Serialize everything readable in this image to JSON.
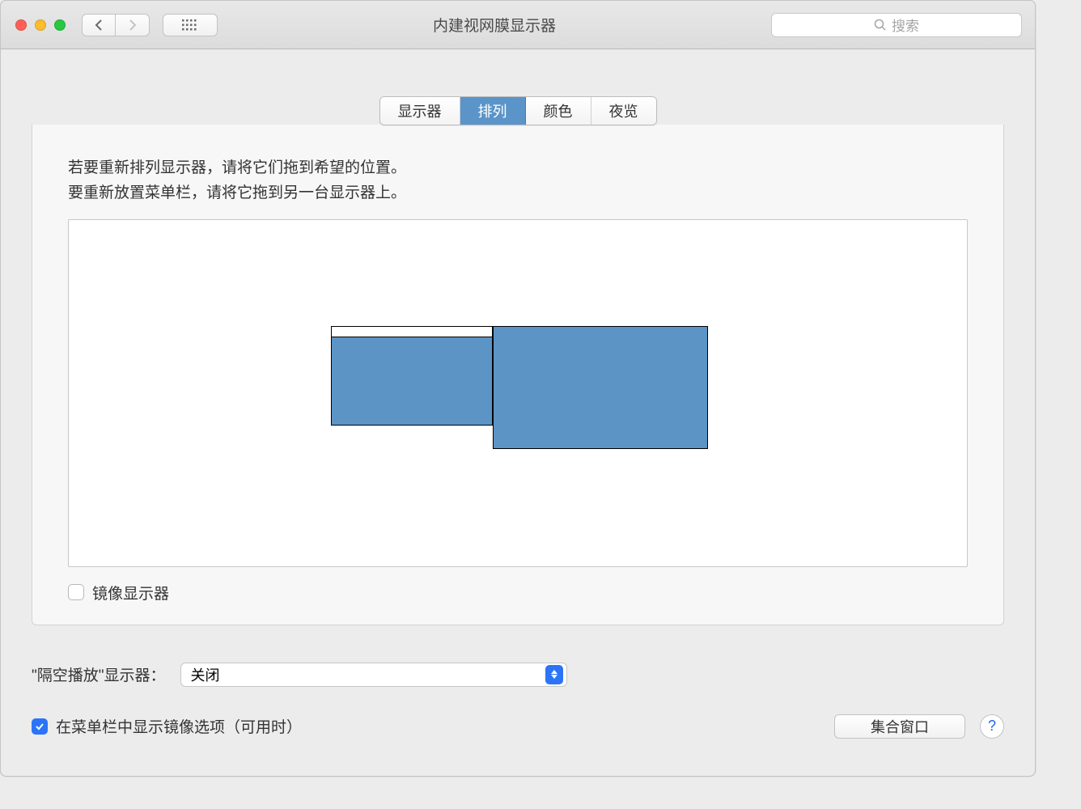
{
  "window": {
    "title": "内建视网膜显示器"
  },
  "search": {
    "placeholder": "搜索"
  },
  "tabs": [
    {
      "label": "显示器"
    },
    {
      "label": "排列"
    },
    {
      "label": "颜色"
    },
    {
      "label": "夜览"
    }
  ],
  "instructions": {
    "line1": "若要重新排列显示器，请将它们拖到希望的位置。",
    "line2": "要重新放置菜单栏，请将它拖到另一台显示器上。"
  },
  "mirror": {
    "label": "镜像显示器"
  },
  "airplay": {
    "label": "\"隔空播放\"显示器：",
    "value": "关闭"
  },
  "show_mirror_in_menu": {
    "label": "在菜单栏中显示镜像选项（可用时）"
  },
  "gather": {
    "label": "集合窗口"
  }
}
